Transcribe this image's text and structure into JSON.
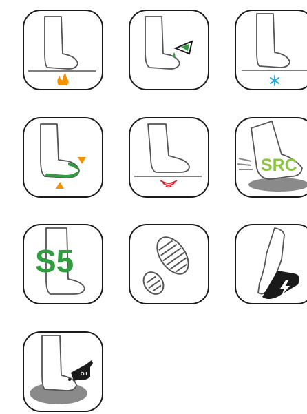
{
  "icons": [
    {
      "id": "heat-resistant-sole-icon"
    },
    {
      "id": "chemical-resistant-icon"
    },
    {
      "id": "cold-insulation-icon"
    },
    {
      "id": "protective-toecap-midsole-icon"
    },
    {
      "id": "antistatic-icon"
    },
    {
      "id": "slip-resistant-icon",
      "label": "SRC"
    },
    {
      "id": "safety-class-icon",
      "label": "S5"
    },
    {
      "id": "cleated-outsole-icon"
    },
    {
      "id": "electrical-hazard-icon"
    },
    {
      "id": "oil-resistant-icon",
      "label": "OIL"
    }
  ],
  "colors": {
    "green": "#2e9e3e",
    "lime": "#8cc63f",
    "orange": "#f39200",
    "blue": "#29a8e0",
    "red": "#d32027",
    "outline": "#1a1a1a"
  }
}
